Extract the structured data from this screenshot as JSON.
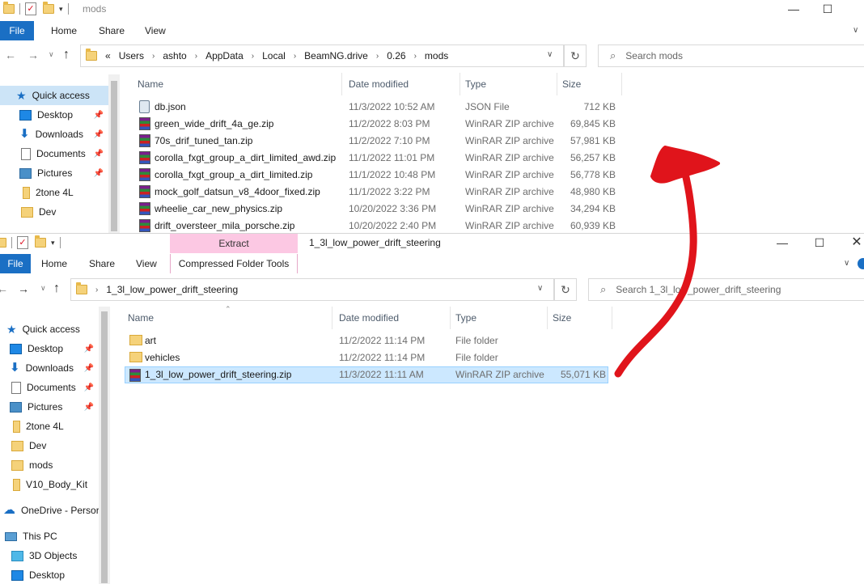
{
  "win1": {
    "title": "mods",
    "tabs": {
      "file": "File",
      "home": "Home",
      "share": "Share",
      "view": "View"
    },
    "breadcrumb": [
      "«",
      "Users",
      "ashto",
      "AppData",
      "Local",
      "BeamNG.drive",
      "0.26",
      "mods"
    ],
    "search_placeholder": "Search mods",
    "columns": {
      "name": "Name",
      "date": "Date modified",
      "type": "Type",
      "size": "Size"
    },
    "nav": [
      {
        "label": "Quick access",
        "icon": "star-icon",
        "pinned": false
      },
      {
        "label": "Desktop",
        "icon": "desktop-icon",
        "pinned": true
      },
      {
        "label": "Downloads",
        "icon": "download-icon",
        "pinned": true
      },
      {
        "label": "Documents",
        "icon": "documents-icon",
        "pinned": true
      },
      {
        "label": "Pictures",
        "icon": "pictures-icon",
        "pinned": true
      },
      {
        "label": "2tone 4L",
        "icon": "folder-icon",
        "pinned": false
      },
      {
        "label": "Dev",
        "icon": "folder-icon",
        "pinned": false
      }
    ],
    "files": [
      {
        "name": "db.json",
        "date": "11/3/2022 10:52 AM",
        "type": "JSON File",
        "size": "712 KB",
        "icon": "json-file-icon"
      },
      {
        "name": "green_wide_drift_4a_ge.zip",
        "date": "11/2/2022 8:03 PM",
        "type": "WinRAR ZIP archive",
        "size": "69,845 KB",
        "icon": "winrar-zip-icon"
      },
      {
        "name": "70s_drif_tuned_tan.zip",
        "date": "11/2/2022 7:10 PM",
        "type": "WinRAR ZIP archive",
        "size": "57,981 KB",
        "icon": "winrar-zip-icon"
      },
      {
        "name": "corolla_fxgt_group_a_dirt_limited_awd.zip",
        "date": "11/1/2022 11:01 PM",
        "type": "WinRAR ZIP archive",
        "size": "56,257 KB",
        "icon": "winrar-zip-icon"
      },
      {
        "name": "corolla_fxgt_group_a_dirt_limited.zip",
        "date": "11/1/2022 10:48 PM",
        "type": "WinRAR ZIP archive",
        "size": "56,778 KB",
        "icon": "winrar-zip-icon"
      },
      {
        "name": "mock_golf_datsun_v8_4door_fixed.zip",
        "date": "11/1/2022 3:22 PM",
        "type": "WinRAR ZIP archive",
        "size": "48,980 KB",
        "icon": "winrar-zip-icon"
      },
      {
        "name": "wheelie_car_new_physics.zip",
        "date": "10/20/2022 3:36 PM",
        "type": "WinRAR ZIP archive",
        "size": "34,294 KB",
        "icon": "winrar-zip-icon"
      },
      {
        "name": "drift_oversteer_mila_porsche.zip",
        "date": "10/20/2022 2:40 PM",
        "type": "WinRAR ZIP archive",
        "size": "60,939 KB",
        "icon": "winrar-zip-icon"
      }
    ]
  },
  "win2": {
    "title": "1_3l_low_power_drift_steering",
    "context_tab": "Extract",
    "tabs": {
      "file": "File",
      "home": "Home",
      "share": "Share",
      "view": "View",
      "tools": "Compressed Folder Tools"
    },
    "breadcrumb": [
      "1_3l_low_power_drift_steering"
    ],
    "search_placeholder": "Search 1_3l_low_power_drift_steering",
    "columns": {
      "name": "Name",
      "date": "Date modified",
      "type": "Type",
      "size": "Size"
    },
    "nav": [
      {
        "label": "Quick access",
        "icon": "star-icon",
        "pinned": false
      },
      {
        "label": "Desktop",
        "icon": "desktop-icon",
        "pinned": true
      },
      {
        "label": "Downloads",
        "icon": "download-icon",
        "pinned": true
      },
      {
        "label": "Documents",
        "icon": "documents-icon",
        "pinned": true
      },
      {
        "label": "Pictures",
        "icon": "pictures-icon",
        "pinned": true
      },
      {
        "label": "2tone 4L",
        "icon": "folder-icon",
        "pinned": false
      },
      {
        "label": "Dev",
        "icon": "folder-icon",
        "pinned": false
      },
      {
        "label": "mods",
        "icon": "folder-icon",
        "pinned": false
      },
      {
        "label": "V10_Body_Kit",
        "icon": "folder-icon",
        "pinned": false
      },
      {
        "label": "OneDrive - Persor",
        "icon": "cloud-icon",
        "pinned": false
      },
      {
        "label": "This PC",
        "icon": "pc-icon",
        "pinned": false
      },
      {
        "label": "3D Objects",
        "icon": "3d-objects-icon",
        "pinned": false
      },
      {
        "label": "Desktop",
        "icon": "desktop-icon",
        "pinned": false
      }
    ],
    "files": [
      {
        "name": "art",
        "date": "11/2/2022 11:14 PM",
        "type": "File folder",
        "size": "",
        "icon": "folder-icon"
      },
      {
        "name": "vehicles",
        "date": "11/2/2022 11:14 PM",
        "type": "File folder",
        "size": "",
        "icon": "folder-icon"
      },
      {
        "name": "1_3l_low_power_drift_steering.zip",
        "date": "11/3/2022 11:11 AM",
        "type": "WinRAR ZIP archive",
        "size": "55,071 KB",
        "icon": "winrar-zip-icon",
        "selected": true
      }
    ]
  },
  "colors": {
    "accent": "#1a6fc4",
    "context_tab": "#fcc8e3",
    "selection": "#cce8ff",
    "arrow": "#e0141b"
  }
}
